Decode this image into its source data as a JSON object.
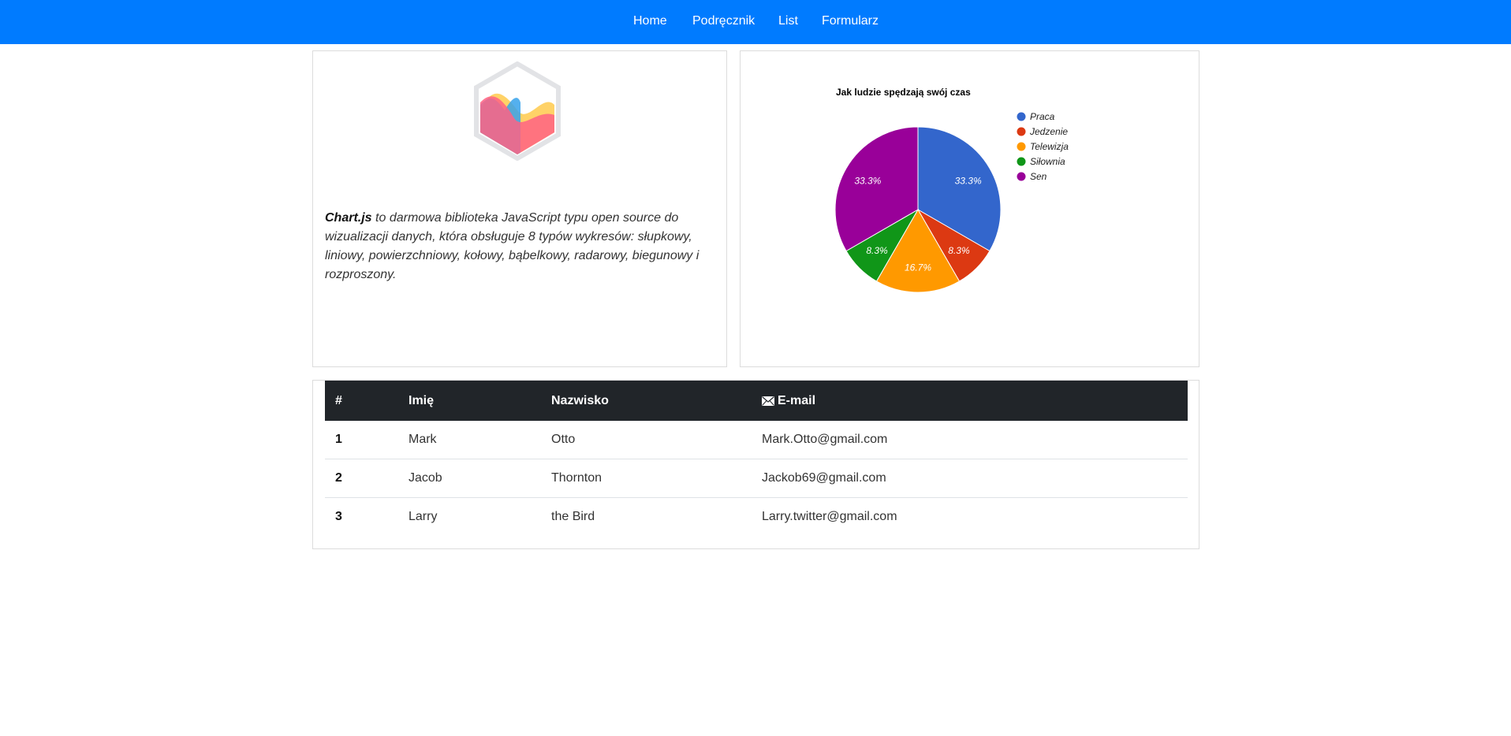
{
  "nav": {
    "items": [
      {
        "label": "Home"
      },
      {
        "label": "Podręcznik"
      },
      {
        "label": "List"
      },
      {
        "label": "Formularz"
      }
    ],
    "color": "#007bff"
  },
  "intro": {
    "brand": "Chart.js",
    "text": " to darmowa biblioteka JavaScript typu open source do wizualizacji danych, która obsługuje 8 typów wykresów: słupkowy, liniowy, powierzchniowy, kołowy, bąbelkowy, radarowy, biegunowy i rozproszony.",
    "logo_icon": "chartjs-logo-icon"
  },
  "chart_data": {
    "type": "pie",
    "title": "Jak ludzie spędzają swój czas",
    "categories": [
      "Praca",
      "Jedzenie",
      "Telewizja",
      "Siłownia",
      "Sen"
    ],
    "values": [
      8,
      2,
      4,
      2,
      8
    ],
    "labels": [
      "33.3%",
      "8.3%",
      "16.7%",
      "8.3%",
      "33.3%"
    ],
    "colors": [
      "#3366cc",
      "#dc3912",
      "#ff9900",
      "#109618",
      "#990099"
    ],
    "legend": "right"
  },
  "table": {
    "headers": [
      "#",
      "Imię",
      "Nazwisko",
      "E-mail"
    ],
    "header_icon": "mail-icon",
    "rows": [
      [
        "1",
        "Mark",
        "Otto",
        "Mark.Otto@gmail.com"
      ],
      [
        "2",
        "Jacob",
        "Thornton",
        "Jackob69@gmail.com"
      ],
      [
        "3",
        "Larry",
        "the Bird",
        "Larry.twitter@gmail.com"
      ]
    ]
  }
}
